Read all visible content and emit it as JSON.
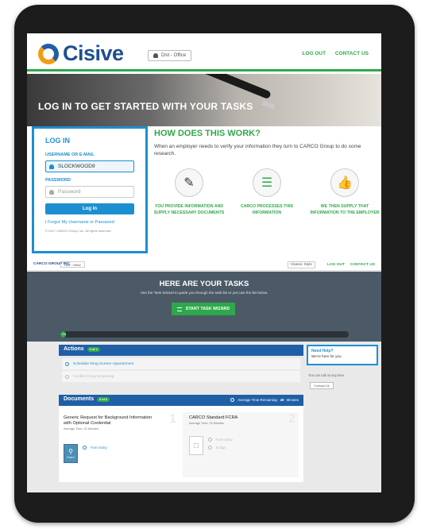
{
  "login_page": {
    "logo_text": "Cisive",
    "office_label": "Dist - Office",
    "links": [
      "LOG OUT",
      "CONTACT US"
    ],
    "hero_title": "LOG IN TO GET STARTED WITH YOUR TASKS",
    "login": {
      "title": "LOG IN",
      "username_label": "USERNAME OR E-MAIL",
      "username_value": "SLOCKWOOD9",
      "password_label": "PASSWORD",
      "password_placeholder": "Password",
      "button": "Log In",
      "forgot": "I Forgot My Username or Password",
      "copyright": "© 2017 CARCO Group, Inc. All rights reserved."
    },
    "how": {
      "title": "HOW DOES THIS WORK?",
      "text": "When an employer needs to verify your information they turn to CARCO Group to do some research.",
      "steps": [
        {
          "icon": "pen-icon",
          "glyph": "✎",
          "text": "YOU PROVIDE INFORMATION AND SUPPLY NECESSARY DOCUMENTS"
        },
        {
          "icon": "checklist-icon",
          "glyph": "☰",
          "text": "CARCO PROCESSES THIS INFORMATION"
        },
        {
          "icon": "thumbs-up-icon",
          "glyph": "👍",
          "text": "WE THEN SUPPLY THAT INFORMATION TO THE EMPLOYER"
        }
      ]
    }
  },
  "dashboard": {
    "brand": "CARCO GROUP INC.",
    "office_label": "Dist - Office",
    "classic_style": "Classic Style",
    "links": [
      "LOG OUT",
      "CONTACT US"
    ],
    "banner_title": "HERE ARE YOUR TASKS",
    "banner_sub": "Use the Task Wizard to guide you through the task list or just use the list below.",
    "wizard_button": "START TASK WIZARD",
    "progress_percent": 2,
    "progress_label": "0%",
    "actions": {
      "title": "Actions",
      "badge": "0 of 2",
      "items": [
        "Schedule Drug Screen Appointment",
        "Confirm Drug Screening"
      ]
    },
    "help": {
      "title": "Need Help?",
      "text": "We're here for you.",
      "call": "You can call us any time.",
      "contact_button": "Contact Us"
    },
    "documents": {
      "title": "Documents",
      "badge": "0 of 2",
      "time_label": "Average Time Remaining:",
      "time_value": "40",
      "time_unit": "Minutes",
      "cards": [
        {
          "title": "Generic Request for Background Information with Optional Credential",
          "sub": "Average Time: 20 Minutes",
          "icon_label": "Form",
          "options": [
            "Form Entry"
          ],
          "number": "1"
        },
        {
          "title": "CARCO Standard FCRA",
          "sub": "Average Time: 20 Minutes",
          "icon_label": "",
          "options": [
            "Form Entry",
            "E-Sign"
          ],
          "number": "2"
        }
      ]
    }
  },
  "colors": {
    "green": "#2ea84a",
    "blue": "#1d8fd1",
    "navy": "#1f5fa6"
  }
}
